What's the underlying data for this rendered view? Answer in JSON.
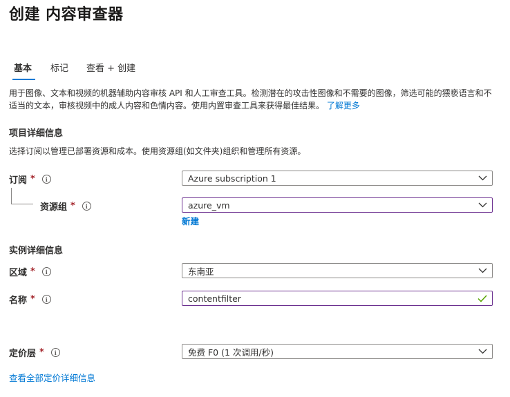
{
  "page": {
    "title": "创建 内容审查器"
  },
  "tabs": [
    {
      "label": "基本",
      "active": true
    },
    {
      "label": "标记"
    },
    {
      "label": "查看 + 创建"
    }
  ],
  "description": {
    "text": "用于图像、文本和视频的机器辅助内容审核 API 和人工审查工具。检测潜在的攻击性图像和不需要的图像，筛选可能的猥亵语言和不适当的文本，审核视频中的成人内容和色情内容。使用内置审查工具来获得最佳结果。",
    "learn_more": "了解更多"
  },
  "project_details": {
    "title": "项目详细信息",
    "description": "选择订阅以管理已部署资源和成本。使用资源组(如文件夹)组织和管理所有资源。",
    "subscription": {
      "label": "订阅",
      "value": "Azure subscription 1"
    },
    "resource_group": {
      "label": "资源组",
      "value": "azure_vm",
      "new_link": "新建"
    }
  },
  "instance_details": {
    "title": "实例详细信息",
    "region": {
      "label": "区域",
      "value": "东南亚"
    },
    "name": {
      "label": "名称",
      "value": "contentfilter"
    }
  },
  "pricing": {
    "label": "定价层",
    "value": "免费 F0 (1 次调用/秒)",
    "details_link": "查看全部定价详细信息"
  },
  "common": {
    "required_mark": "*",
    "info_glyph": "i"
  },
  "colors": {
    "accent": "#0078d4",
    "required": "#a4262c",
    "valid": "#57a300",
    "focus_border": "#6b2f8f"
  },
  "icons": [
    "info-icon",
    "chevron-down-icon",
    "checkmark-icon"
  ]
}
